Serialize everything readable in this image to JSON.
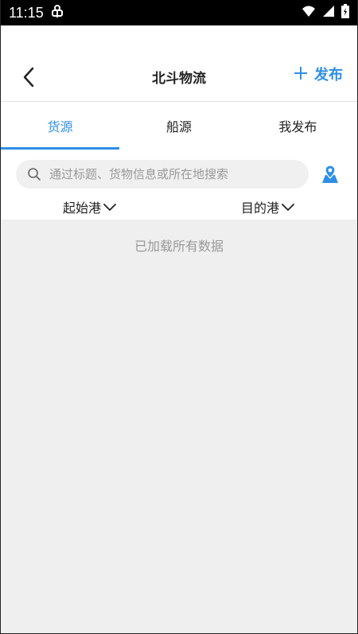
{
  "status_bar": {
    "time": "11:15",
    "left_icon": "bug-icon",
    "right_icons": [
      "wifi-icon",
      "signal-icon",
      "battery-icon"
    ]
  },
  "header": {
    "title": "北斗物流",
    "back_icon": "chevron-left-icon",
    "publish_label": "发布",
    "publish_icon": "plus-icon"
  },
  "tabs": [
    {
      "label": "货源",
      "active": true
    },
    {
      "label": "船源",
      "active": false
    },
    {
      "label": "我发布",
      "active": false
    }
  ],
  "search": {
    "placeholder": "通过标题、货物信息或所在地搜索",
    "value": "",
    "map_icon": "map-pin-icon"
  },
  "filters": [
    {
      "label": "起始港"
    },
    {
      "label": "目的港"
    }
  ],
  "content": {
    "empty_message": "已加载所有数据"
  },
  "colors": {
    "accent": "#2e8fe6",
    "background": "#efefef"
  }
}
